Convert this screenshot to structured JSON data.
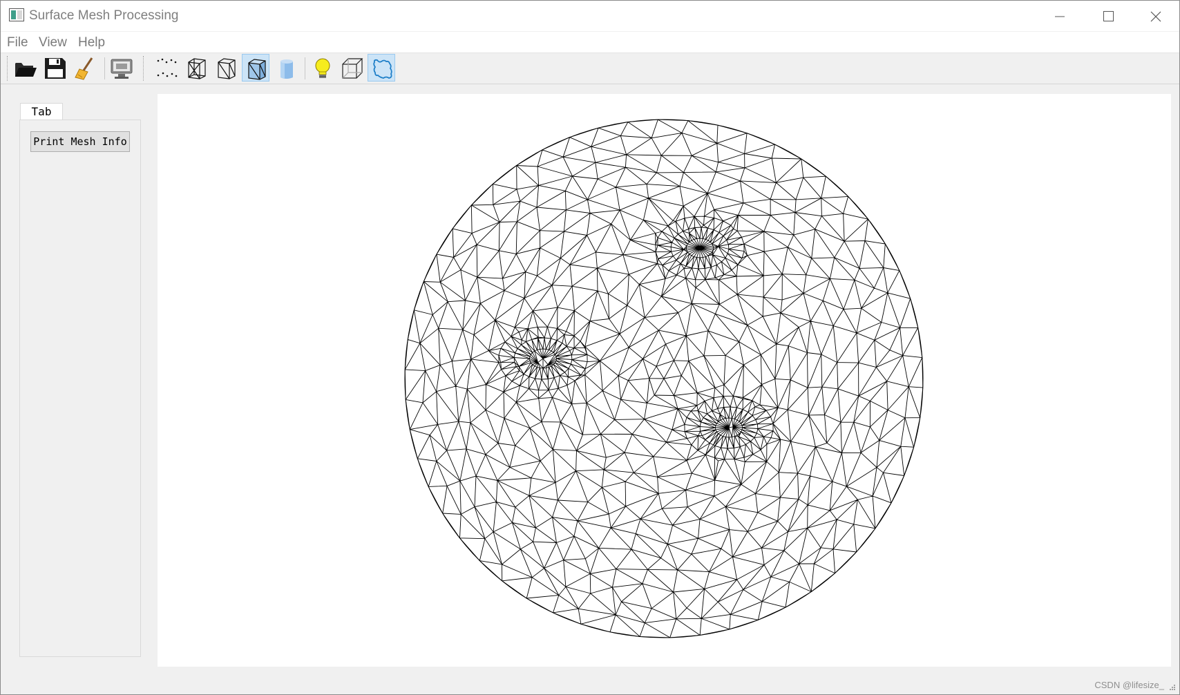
{
  "window": {
    "title": "Surface Mesh Processing"
  },
  "menubar": {
    "items": [
      {
        "label": "File"
      },
      {
        "label": "View"
      },
      {
        "label": "Help"
      }
    ]
  },
  "toolbar": {
    "buttons": [
      {
        "icon": "open-folder-icon",
        "active": false
      },
      {
        "icon": "save-icon",
        "active": false
      },
      {
        "icon": "broom-clear-icon",
        "active": false
      },
      {
        "icon": "screenshot-monitor-icon",
        "active": false
      },
      {
        "icon": "points-icon",
        "active": false
      },
      {
        "icon": "wireframe-icon",
        "active": false
      },
      {
        "icon": "hidden-line-icon",
        "active": false
      },
      {
        "icon": "flat-lines-icon",
        "active": true
      },
      {
        "icon": "flat-shading-icon",
        "active": false
      },
      {
        "icon": "lighting-bulb-icon",
        "active": false
      },
      {
        "icon": "bounding-box-icon",
        "active": false
      },
      {
        "icon": "boundary-icon",
        "active": true
      }
    ]
  },
  "side_panel": {
    "tab_label": "Tab",
    "print_button_label": "Print Mesh Info"
  },
  "viewport": {
    "content": "triangle mesh disk wireframe"
  },
  "watermark": "CSDN @lifesize_",
  "colors": {
    "active_button_bg": "#cce4f7",
    "active_button_border": "#99c9ef",
    "mesh_line": "#000000",
    "viewport_bg": "#ffffff"
  }
}
